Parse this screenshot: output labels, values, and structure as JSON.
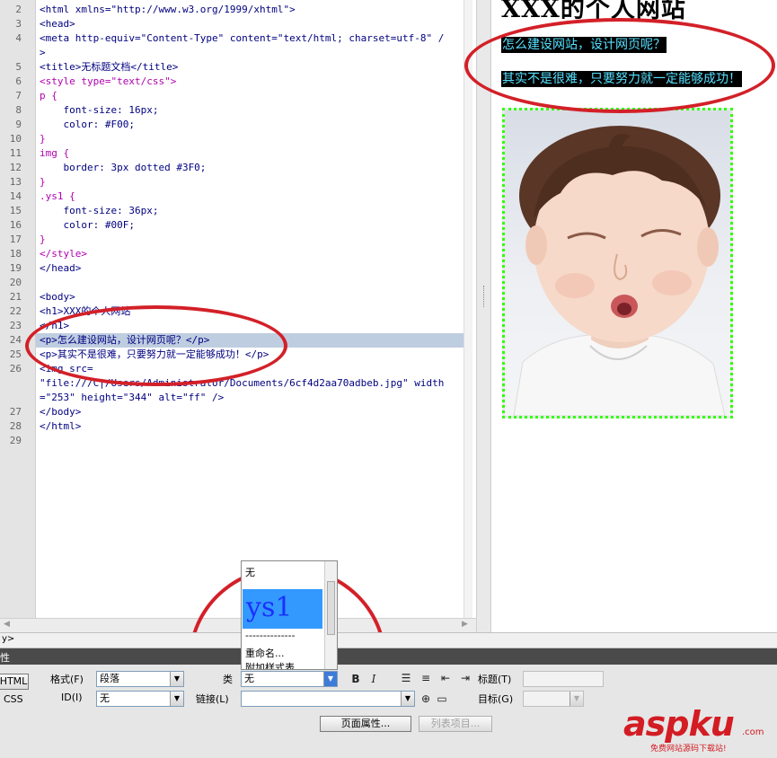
{
  "code": {
    "lines": [
      {
        "n": "2",
        "t": "<html xmlns=\"http://www.w3.org/1999/xhtml\">"
      },
      {
        "n": "3",
        "t": "<head>"
      },
      {
        "n": "4",
        "t": "<meta http-equiv=\"Content-Type\" content=\"text/html; charset=utf-8\" /"
      },
      {
        "n": "",
        "t": ">"
      },
      {
        "n": "5",
        "t": "<title>无标题文档</title>"
      },
      {
        "n": "6",
        "t": "<style type=\"text/css\">"
      },
      {
        "n": "7",
        "t": "p {"
      },
      {
        "n": "8",
        "t": "    font-size: 16px;"
      },
      {
        "n": "9",
        "t": "    color: #F00;"
      },
      {
        "n": "10",
        "t": "}"
      },
      {
        "n": "11",
        "t": "img {"
      },
      {
        "n": "12",
        "t": "    border: 3px dotted #3F0;"
      },
      {
        "n": "13",
        "t": "}"
      },
      {
        "n": "14",
        "t": ".ys1 {"
      },
      {
        "n": "15",
        "t": "    font-size: 36px;"
      },
      {
        "n": "16",
        "t": "    color: #00F;"
      },
      {
        "n": "17",
        "t": "}"
      },
      {
        "n": "18",
        "t": "</style>"
      },
      {
        "n": "19",
        "t": "</head>"
      },
      {
        "n": "20",
        "t": ""
      },
      {
        "n": "21",
        "t": "<body>"
      },
      {
        "n": "22",
        "t": "<h1>XXX的个人网站"
      },
      {
        "n": "23",
        "t": "</h1>"
      },
      {
        "n": "24",
        "t": "<p>怎么建设网站，设计网页呢？</p>"
      },
      {
        "n": "25",
        "t": "<p>其实不是很难，只要努力就一定能够成功！</p>"
      },
      {
        "n": "26",
        "t": "<img src="
      },
      {
        "n": "",
        "t": "\"file:///C|/Users/Administrator/Documents/6cf4d2aa70adbeb.jpg\" width"
      },
      {
        "n": "",
        "t": "=\"253\" height=\"344\" alt=\"ff\" />"
      },
      {
        "n": "27",
        "t": "</body>"
      },
      {
        "n": "28",
        "t": "</html>"
      },
      {
        "n": "29",
        "t": ""
      }
    ]
  },
  "design": {
    "site_title": "XXX的个人网站",
    "p1": "怎么建设网站，设计网页呢？",
    "p2": "其实不是很难，只要努力就一定能够成功！",
    "image_alt": "ff"
  },
  "tag_selector": "y>",
  "props_panel": {
    "header": "性",
    "html_button": "HTML",
    "css_button": "CSS",
    "format_label": "格式(F)",
    "format_value": "段落",
    "id_label": "ID(I)",
    "id_value": "无",
    "class_label": "类",
    "class_value": "无",
    "link_label": "链接(L)",
    "link_value": "",
    "bold": "B",
    "italic": "I",
    "title_label": "标题(T)",
    "target_label": "目标(G)",
    "page_props_button": "页面属性...",
    "list_item_button": "列表项目..."
  },
  "class_dropdown": {
    "items": [
      "无",
      "ys1",
      "--------------",
      "重命名...",
      "附加样式表..."
    ],
    "selected": "ys1"
  },
  "watermark": {
    "main": "aspku",
    "domain": ".com",
    "tagline": "免费网站源码下载站!"
  },
  "colors": {
    "annotation_red": "#d32028",
    "design_text": "#55e0ff",
    "img_border": "#33ff00",
    "ys1_blue": "#1a30ff",
    "selection_blue": "#3399ff"
  }
}
